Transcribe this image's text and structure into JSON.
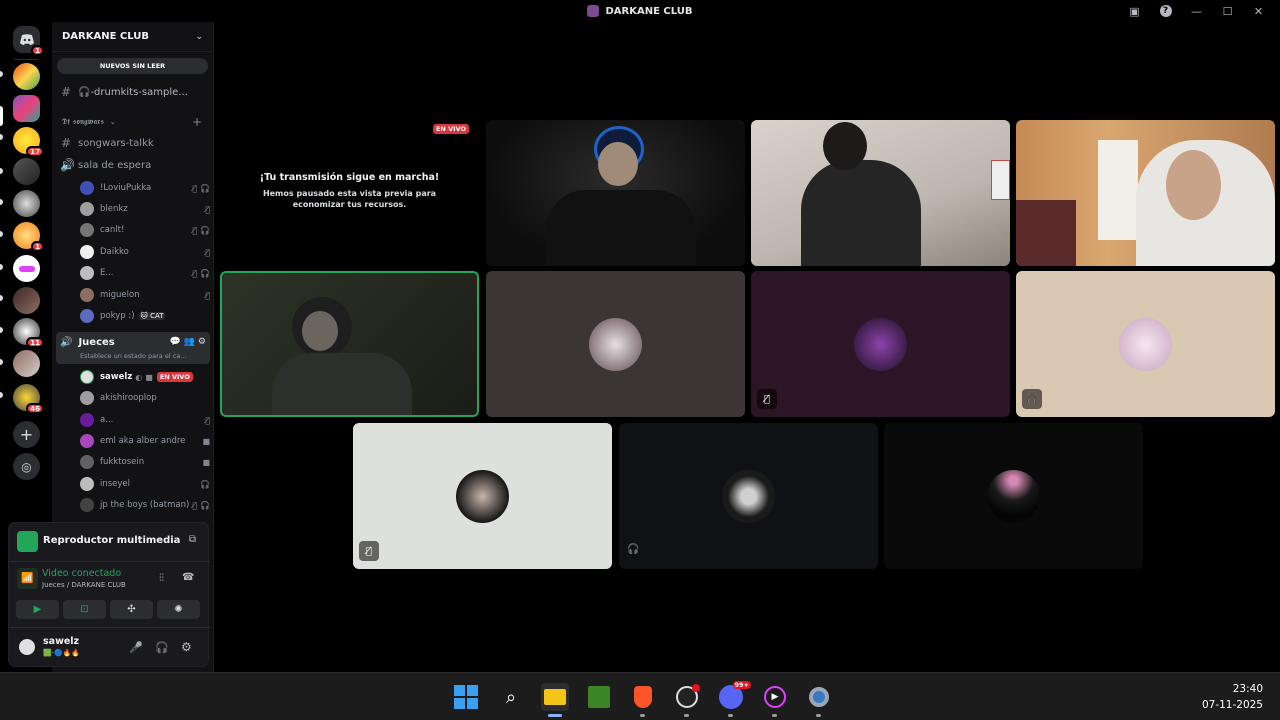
{
  "window": {
    "title": "DARKANE CLUB"
  },
  "guilds": [
    {
      "name": "home",
      "badge": "1"
    },
    {
      "name": "server-1",
      "badge": ""
    },
    {
      "name": "server-2",
      "badge": ""
    },
    {
      "name": "server-3",
      "badge": "17"
    },
    {
      "name": "server-4",
      "badge": ""
    },
    {
      "name": "server-5",
      "badge": ""
    },
    {
      "name": "server-6",
      "badge": "1"
    },
    {
      "name": "server-7",
      "badge": ""
    },
    {
      "name": "server-8",
      "badge": ""
    },
    {
      "name": "server-9",
      "badge": "11"
    },
    {
      "name": "server-10",
      "badge": ""
    },
    {
      "name": "server-11",
      "badge": "46"
    }
  ],
  "server": {
    "name": "DARKANE CLUB",
    "new_unread": "NUEVOS SIN LEER"
  },
  "channels": {
    "drumkits": "🎧-drumkits-sample...",
    "category": "𝕯𝖋 𝖘𝖔𝖓𝖌𝖜𝖆𝖗𝖘",
    "songwars": "songwars-talkk",
    "waiting": "sala de espera",
    "judges": "Jueces",
    "judges_status": "Establece un estado para el ca..."
  },
  "waiting_users": [
    "!LoviuPukka",
    "blenkz",
    "canlt!",
    "Daikko",
    "E...",
    "miguelon",
    "pokyp :)"
  ],
  "cat_tag": "CAT",
  "judges_users": [
    "sawelz",
    "akishirooplop",
    "a...",
    "eml aka alber andre",
    "fukktosein",
    "inseyel",
    "jp the boys (batman)"
  ],
  "live_label": "EN VIVO",
  "media_player": {
    "title": "Reproductor multimedia"
  },
  "voice": {
    "status": "Video conectado",
    "location": "Jueces / DARKANE CLUB"
  },
  "user": {
    "name": "sawelz"
  },
  "stream_notice": {
    "title": "¡Tu transmisión sigue en marcha!",
    "body": "Hemos pausado esta vista previa para economizar tus recursos."
  },
  "clock": {
    "time": "23:40",
    "date": "07-11-2025"
  },
  "taskbar_badge": "99+"
}
